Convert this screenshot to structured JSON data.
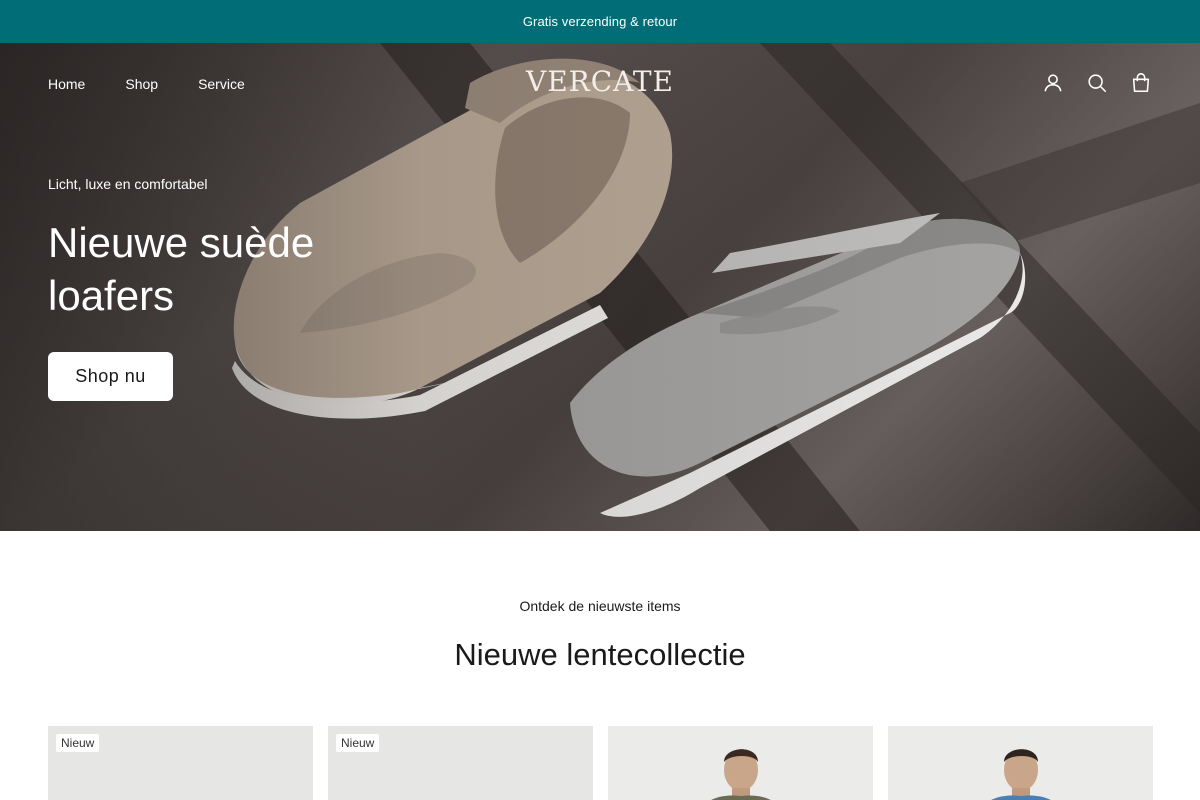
{
  "announcement": {
    "text": "Gratis verzending & retour"
  },
  "header": {
    "nav": [
      "Home",
      "Shop",
      "Service"
    ],
    "logo": "VERCATE",
    "icons": [
      "account-icon",
      "search-icon",
      "cart-icon"
    ]
  },
  "hero": {
    "subtitle": "Licht, luxe en comfortabel",
    "title": "Nieuwe suède loafers",
    "button": "Shop nu",
    "image": "suede-loafers-photo"
  },
  "collection": {
    "eyebrow": "Ontdek de nieuwste items",
    "title": "Nieuwe lentecollectie",
    "products": [
      {
        "badge": "Nieuw"
      },
      {
        "badge": "Nieuw"
      },
      {
        "badge": ""
      },
      {
        "badge": ""
      }
    ]
  },
  "colors": {
    "announcement_bg": "#006d77",
    "accent": "#006d77"
  }
}
